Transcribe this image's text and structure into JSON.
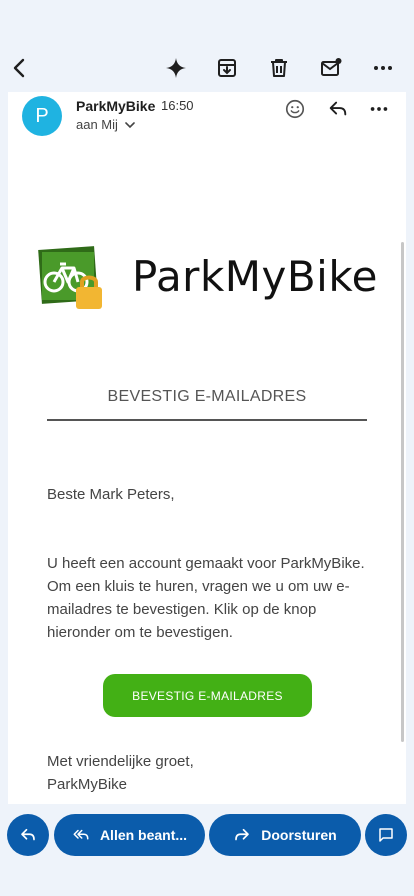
{
  "toolbar": {
    "back_icon": "arrow-left-icon",
    "icons": [
      "sparkle-icon",
      "archive-icon",
      "trash-icon",
      "mark-unread-icon",
      "more-horizontal-icon"
    ]
  },
  "email": {
    "sender_initial": "P",
    "sender": "ParkMyBike",
    "time": "16:50",
    "recipient": "aan Mij",
    "brand": "ParkMyBike",
    "title": "BEVESTIG E-MAILADRES",
    "greeting": "Beste Mark Peters,",
    "body": "U heeft een account gemaakt voor ParkMyBike. Om een kluis te huren, vragen we u om uw e-mailadres te bevestigen. Klik op de knop hieronder om te bevestigen.",
    "cta_label": "BEVESTIG E-MAILADRES",
    "signoff_line1": "Met vriendelijke groet,",
    "signoff_line2": "ParkMyBike"
  },
  "actions": {
    "reply_all_label": "Allen beant...",
    "forward_label": "Doorsturen"
  },
  "colors": {
    "accent": "#0b5cab",
    "cta": "#43b015",
    "avatar": "#1fb3e1",
    "logo_green": "#3a7d1f",
    "logo_lock": "#f2b632"
  }
}
